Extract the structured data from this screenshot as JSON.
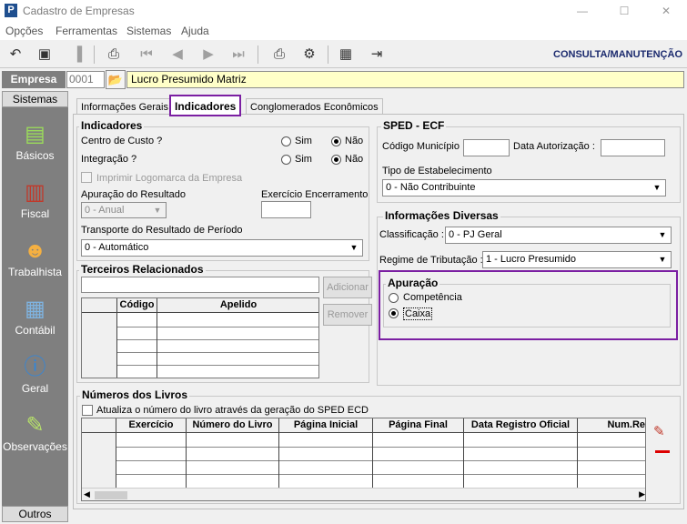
{
  "window": {
    "title": "Cadastro de Empresas",
    "min": "—",
    "max": "☐",
    "close": "✕"
  },
  "menu": [
    "Opções",
    "Ferramentas",
    "Sistemas",
    "Ajuda"
  ],
  "toolbar": {
    "mode": "CONSULTA/MANUTENÇÃO"
  },
  "empresa": {
    "label": "Empresa",
    "code": "0001",
    "name": "Lucro Presumido Matriz"
  },
  "sidebar": {
    "header": "Sistemas",
    "footer": "Outros",
    "items": [
      "Básicos",
      "Fiscal",
      "Trabalhista",
      "Contábil",
      "Geral",
      "Observações"
    ]
  },
  "tabs": [
    "Informações Gerais",
    "Indicadores",
    "Conglomerados Econômicos"
  ],
  "indicadores": {
    "title": "Indicadores",
    "centro_custo": "Centro de Custo ?",
    "integracao": "Integração ?",
    "sim": "Sim",
    "nao": "Não",
    "imprimir_logo": "Imprimir Logomarca da Empresa",
    "apuracao_resultado": "Apuração do Resultado",
    "apuracao_value": "0 - Anual",
    "exercicio_encerramento": "Exercício Encerramento",
    "transporte": "Transporte do Resultado de Período",
    "transporte_value": "0 - Automático"
  },
  "terceiros": {
    "title": "Terceiros Relacionados",
    "adicionar": "Adicionar",
    "remover": "Remover",
    "col_codigo": "Código",
    "col_apelido": "Apelido"
  },
  "sped": {
    "title": "SPED - ECF",
    "codigo_municipio": "Código Município :",
    "data_autorizacao": "Data Autorização :",
    "tipo_estabelecimento": "Tipo de Estabelecimento",
    "tipo_value": "0 - Não Contribuinte"
  },
  "diversas": {
    "title": "Informações Diversas",
    "classificacao": "Classificação :",
    "classificacao_value": "0 - PJ Geral",
    "regime": "Regime de Tributação :",
    "regime_value": "1 - Lucro Presumido"
  },
  "apuracao": {
    "title": "Apuração",
    "competencia": "Competência",
    "caixa": "Caixa"
  },
  "livros": {
    "title": "Números dos Livros",
    "atualiza": "Atualiza o número do livro através da geração do SPED ECD",
    "cols": [
      "Exercício",
      "Número do Livro",
      "Página Inicial",
      "Página Final",
      "Data Registro Oficial",
      "Num.Re"
    ]
  },
  "colors": {
    "highlight": "#7b1fa2",
    "sidebar": "#7f7f7f",
    "mode": "#1b2a6e"
  }
}
